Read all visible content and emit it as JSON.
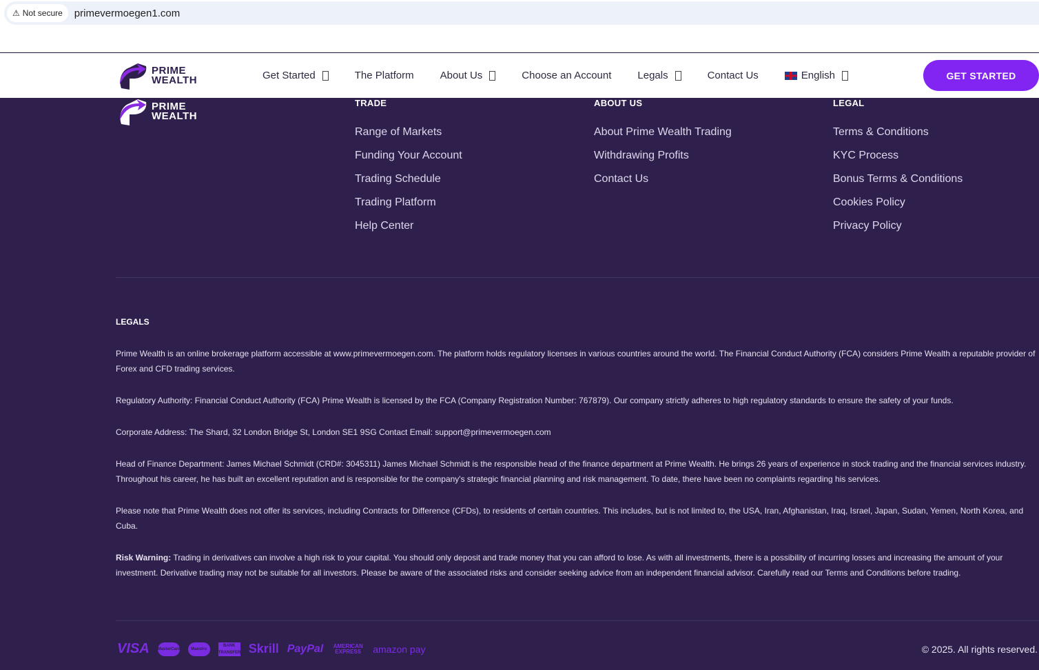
{
  "browser": {
    "security": "Not secure",
    "url": "primevermoegen1.com"
  },
  "brand": {
    "line1": "PRIME",
    "line2": "WEALTH"
  },
  "nav": {
    "items": [
      {
        "label": "Get Started",
        "dropdown": true
      },
      {
        "label": "The Platform",
        "dropdown": false
      },
      {
        "label": "About Us",
        "dropdown": true
      },
      {
        "label": "Choose an Account",
        "dropdown": false
      },
      {
        "label": "Legals",
        "dropdown": true
      },
      {
        "label": "Contact Us",
        "dropdown": false
      }
    ],
    "language": "English",
    "cta": "GET STARTED"
  },
  "footer": {
    "trade": {
      "title": "TRADE",
      "links": [
        "Range of Markets",
        "Funding Your Account",
        "Trading Schedule",
        "Trading Platform",
        "Help Center"
      ]
    },
    "about": {
      "title": "ABOUT US",
      "links": [
        "About Prime Wealth Trading",
        "Withdrawing Profits",
        "Contact Us"
      ]
    },
    "legal": {
      "title": "LEGAL",
      "links": [
        "Terms & Conditions",
        "KYC Process",
        "Bonus Terms & Conditions",
        "Cookies Policy",
        "Privacy Policy"
      ]
    },
    "legals_title": "LEGALS",
    "paragraphs": [
      "Prime Wealth is an online brokerage platform accessible at www.primevermoegen.com. The platform holds regulatory licenses in various countries around the world. The Financial Conduct Authority (FCA) considers Prime Wealth a reputable provider of Forex and CFD trading services.",
      "Regulatory Authority: Financial Conduct Authority (FCA) Prime Wealth is licensed by the FCA (Company Registration Number: 767879). Our company strictly adheres to high regulatory standards to ensure the safety of your funds.",
      "Corporate Address: The Shard, 32 London Bridge St, London SE1 9SG Contact Email: support@primevermoegen.com",
      "Head of Finance Department: James Michael Schmidt (CRD#: 3045311) James Michael Schmidt is the responsible head of the finance department at Prime Wealth. He brings 26 years of experience in stock trading and the financial services industry. Throughout his career, he has built an excellent reputation and is responsible for the company's strategic financial planning and risk management. To date, there have been no complaints regarding his services.",
      "Please note that Prime Wealth does not offer its services, including Contracts for Difference (CFDs), to residents of certain countries. This includes, but is not limited to, the USA, Iran, Afghanistan, Iraq, Israel, Japan, Sudan, Yemen, North Korea, and Cuba."
    ],
    "risk_label": "Risk Warning:",
    "risk_text": " Trading in derivatives can involve a high risk to your capital. You should only deposit and trade money that you can afford to lose. As with all investments, there is a possibility of incurring losses and increasing the amount of your investment. Derivative trading may not be suitable for all investors. Please be aware of the associated risks and consider seeking advice from an independent financial advisor. Carefully read our Terms and Conditions before trading.",
    "payments": [
      "VISA",
      "MasterCard",
      "Maestro",
      "BANK TRANSFER",
      "Skrill",
      "PayPal",
      "AMERICAN EXPRESS",
      "amazon pay"
    ],
    "copyright": "© 2025. All rights reserved."
  },
  "colors": {
    "accent": "#8224f2",
    "footer_bg": "#2f1f4c"
  }
}
